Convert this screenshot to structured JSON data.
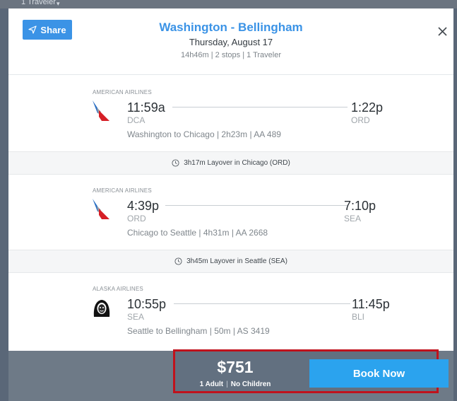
{
  "backdrop": {
    "partial_text": "1 Traveler"
  },
  "header": {
    "share_label": "Share",
    "title": "Washington - Bellingham",
    "date": "Thursday, August 17",
    "summary": "14h46m | 2 stops | 1 Traveler"
  },
  "segments": [
    {
      "airline": "AMERICAN AIRLINES",
      "logo": "american-airlines-logo",
      "dep_time": "11:59a",
      "dep_airport": "DCA",
      "arr_time": "1:22p",
      "arr_airport": "ORD",
      "desc": "Washington to Chicago | 2h23m | AA 489"
    },
    {
      "airline": "AMERICAN AIRLINES",
      "logo": "american-airlines-logo",
      "dep_time": "4:39p",
      "dep_airport": "ORD",
      "arr_time": "7:10p",
      "arr_airport": "SEA",
      "desc": "Chicago to Seattle | 4h31m | AA 2668"
    },
    {
      "airline": "ALASKA AIRLINES",
      "logo": "alaska-airlines-logo",
      "dep_time": "10:55p",
      "dep_airport": "SEA",
      "arr_time": "11:45p",
      "arr_airport": "BLI",
      "desc": "Seattle to Bellingham | 50m | AS 3419"
    }
  ],
  "layovers": [
    {
      "text": "3h17m Layover in Chicago (ORD)"
    },
    {
      "text": "3h45m Layover in Seattle (SEA)"
    }
  ],
  "footer": {
    "price": "$751",
    "adults": "1 Adult",
    "separator": "|",
    "children": "No Children",
    "book_label": "Book Now"
  },
  "colors": {
    "accent": "#3b93e6",
    "book_button": "#2ba3ee",
    "highlight_border": "#c0121c"
  }
}
